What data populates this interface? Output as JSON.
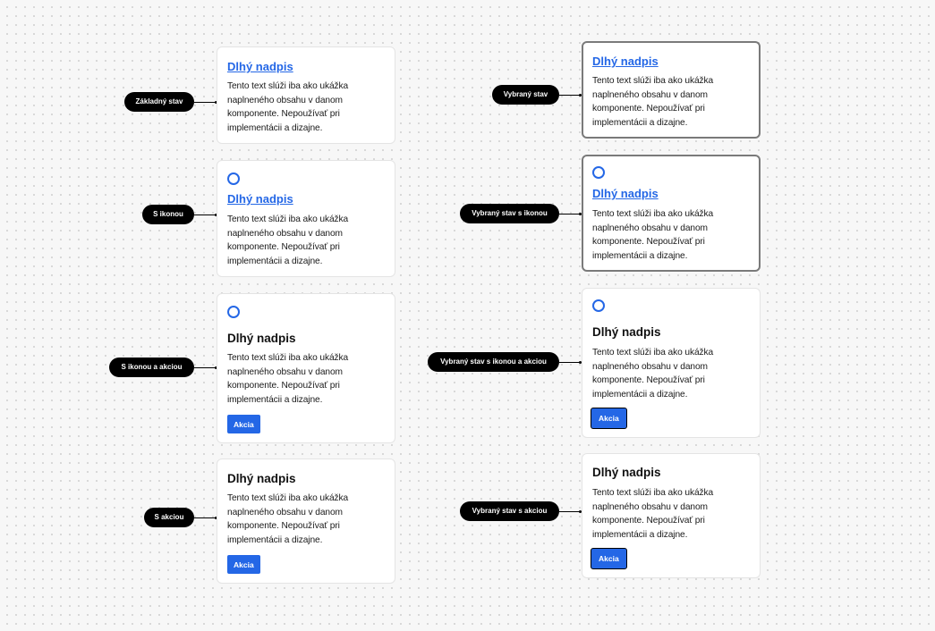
{
  "card_common": {
    "title": "Dlhý nadpis",
    "body": "Tento text slúži iba ako ukážka naplneného obsahu v danom komponente. Nepoužívať pri implementácii a dizajne.",
    "action_label": "Akcia"
  },
  "labels": {
    "basic": "Základný stav",
    "with_icon": "S ikonou",
    "with_icon_action": "S ikonou a akciou",
    "with_action": "S akciou",
    "selected": "Vybraný stav",
    "selected_icon": "Vybraný stav s ikonou",
    "selected_icon_action": "Vybraný stav s ikonou a akciou",
    "selected_action": "Vybraný stav s akciou"
  },
  "icons": {
    "card_icon": "circle-outline-icon"
  },
  "colors": {
    "accent": "#2467e6",
    "selected_border": "#7a7a7a",
    "label_bg": "#000000"
  }
}
